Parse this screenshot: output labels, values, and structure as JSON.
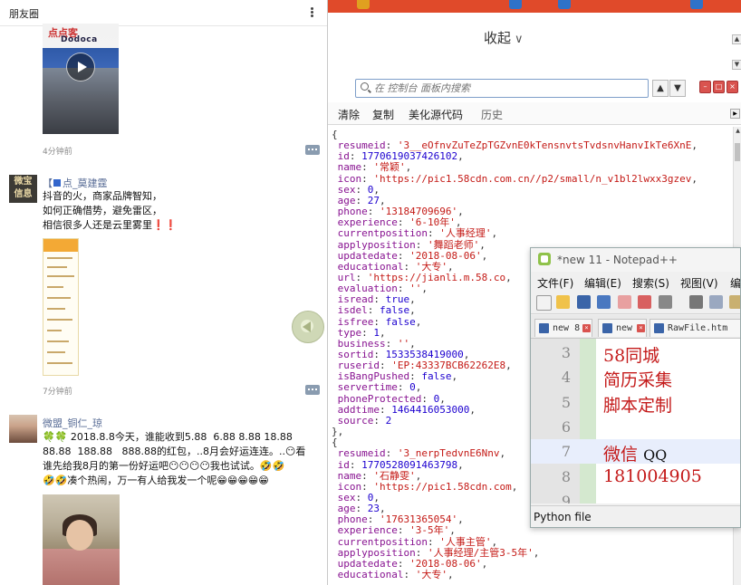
{
  "moments": {
    "title": "朋友圈",
    "video_logo_brand": "Dodoca",
    "video_logo_text": "点点客",
    "posts": [
      {
        "time": "4分钟前"
      },
      {
        "author_prefix": "【",
        "author": "点_莫建霆",
        "avatar_text": "微宝\n信息",
        "text": "抖音的火，商家品牌智知，\n如何正确借势，避免雷区，\n相信很多人还是云里雾里❗❗",
        "time": "7分钟前"
      },
      {
        "author": "微盟_铜仁_琼",
        "text": "🍀🍀 2018.8.8今天，谁能收到5.88  6.88 8.88 18.88\n88.88  188.88   888.88的红包，..8月会好运连连。..😶看\n谁先给我8月的第一份好运吧😶😶😶😶我也试试。🤣🤣\n🤣🤣凑个热闹，万一有人给我发一个呢😁😁😁😁😁"
      }
    ],
    "icons": [
      "more-vertical-icon",
      "play-icon",
      "comment-icon",
      "back-arrow-icon"
    ]
  },
  "browser": {
    "fold_label": "收起",
    "search": {
      "placeholder": "在 控制台 面板内搜索"
    },
    "nav": {
      "up": "▲",
      "down": "▼"
    },
    "toolbar": {
      "clear": "清除",
      "copy": "复制",
      "beautify": "美化源代码",
      "history": "历史"
    },
    "accent": "#e04a2a"
  },
  "console_lines": [
    {
      "type": "brace",
      "text": "{"
    },
    {
      "key": "resumeid",
      "val": "'3__eOfnvZuTeZpTGZvnE0kTensnvtsTvdsnvHanvIkTe6XnE",
      "vtype": "s"
    },
    {
      "key": "id",
      "val": "1770619037426102",
      "vtype": "n"
    },
    {
      "key": "name",
      "val": "'常颖'",
      "vtype": "s"
    },
    {
      "key": "icon",
      "val": "'https://pic1.58cdn.com.cn//p2/small/n_v1bl2lwxx3gzev",
      "vtype": "s"
    },
    {
      "key": "sex",
      "val": "0",
      "vtype": "n"
    },
    {
      "key": "age",
      "val": "27",
      "vtype": "n"
    },
    {
      "key": "phone",
      "val": "'13184709696'",
      "vtype": "s"
    },
    {
      "key": "experience",
      "val": "'6-10年'",
      "vtype": "s"
    },
    {
      "key": "currentposition",
      "val": "'人事经理'",
      "vtype": "s"
    },
    {
      "key": "applyposition",
      "val": "'舞蹈老师'",
      "vtype": "s"
    },
    {
      "key": "updatedate",
      "val": "'2018-08-06'",
      "vtype": "s"
    },
    {
      "key": "educational",
      "val": "'大专'",
      "vtype": "s"
    },
    {
      "key": "url",
      "val": "'https://jianli.m.58.co",
      "vtype": "s"
    },
    {
      "key": "evaluation",
      "val": "''",
      "vtype": "s"
    },
    {
      "key": "isread",
      "val": "true",
      "vtype": "n"
    },
    {
      "key": "isdel",
      "val": "false",
      "vtype": "n"
    },
    {
      "key": "isfree",
      "val": "false",
      "vtype": "n"
    },
    {
      "key": "type",
      "val": "1",
      "vtype": "n"
    },
    {
      "key": "business",
      "val": "''",
      "vtype": "s"
    },
    {
      "key": "sortid",
      "val": "1533538419000",
      "vtype": "n"
    },
    {
      "key": "ruserid",
      "val": "'EP:43337BCB62262E8",
      "vtype": "s"
    },
    {
      "key": "isBangPushed",
      "val": "false",
      "vtype": "n"
    },
    {
      "key": "servertime",
      "val": "0",
      "vtype": "n"
    },
    {
      "key": "phoneProtected",
      "val": "0",
      "vtype": "n"
    },
    {
      "key": "addtime",
      "val": "1464416053000",
      "vtype": "n"
    },
    {
      "key": "source",
      "val": "2",
      "vtype": "n",
      "last": true
    },
    {
      "type": "brace",
      "text": "},"
    },
    {
      "type": "brace",
      "text": "{"
    },
    {
      "key": "resumeid",
      "val": "'3_nerpTedvnE6Nnv",
      "vtype": "s"
    },
    {
      "key": "id",
      "val": "1770528091463798",
      "vtype": "n"
    },
    {
      "key": "name",
      "val": "'石静雯'",
      "vtype": "s"
    },
    {
      "key": "icon",
      "val": "'https://pic1.58cdn.com",
      "vtype": "s"
    },
    {
      "key": "sex",
      "val": "0",
      "vtype": "n"
    },
    {
      "key": "age",
      "val": "23",
      "vtype": "n"
    },
    {
      "key": "phone",
      "val": "'17631365054'",
      "vtype": "s"
    },
    {
      "key": "experience",
      "val": "'3-5年'",
      "vtype": "s"
    },
    {
      "key": "currentposition",
      "val": "'人事主管'",
      "vtype": "s"
    },
    {
      "key": "applyposition",
      "val": "'人事经理/主管3-5年'",
      "vtype": "s"
    },
    {
      "key": "updatedate",
      "val": "'2018-08-06'",
      "vtype": "s"
    },
    {
      "key": "educational",
      "val": "'大专'",
      "vtype": "s"
    }
  ],
  "notepad": {
    "title": "*new 11 - Notepad++",
    "menu": [
      "文件(F)",
      "编辑(E)",
      "搜索(S)",
      "视图(V)",
      "编"
    ],
    "tabs": [
      "new 8",
      "new 6",
      "RawFile.htm"
    ],
    "lines": [
      {
        "no": "3",
        "text": "58同城"
      },
      {
        "no": "4",
        "text": "简历采集"
      },
      {
        "no": "5",
        "text": "脚本定制"
      },
      {
        "no": "6",
        "text": ""
      },
      {
        "no": "7",
        "text": "微信",
        "suffix": "QQ"
      },
      {
        "no": "8",
        "text": "181004905"
      },
      {
        "no": "9",
        "text": ""
      }
    ],
    "status": "Python file"
  }
}
